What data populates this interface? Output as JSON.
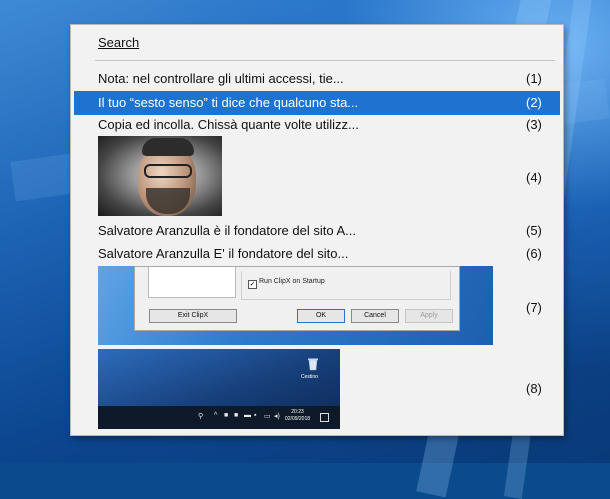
{
  "menu": {
    "search_label": "Search",
    "items": [
      {
        "label": "Nota: nel controllare gli ultimi accessi, tie...",
        "key": "(1)"
      },
      {
        "label": "Il tuo “sesto senso” ti dice che qualcuno sta...",
        "key": "(2)",
        "selected": true
      },
      {
        "label": "Copia ed incolla. Chissà quante volte utilizz...",
        "key": "(3)"
      },
      {
        "key": "(4)",
        "thumbnail": "portrait-photo"
      },
      {
        "label": "Salvatore Aranzulla è il fondatore del sito A...",
        "key": "(5)"
      },
      {
        "label": "Salvatore Aranzulla  E' il fondatore del sito...",
        "key": "(6)"
      },
      {
        "key": "(7)",
        "thumbnail": "clipx-dialog-screenshot"
      },
      {
        "key": "(8)",
        "thumbnail": "desktop-taskbar-screenshot"
      }
    ]
  },
  "clipx_dialog": {
    "startup_checkbox": "Run ClipX on Startup",
    "exit_button": "Exit ClipX",
    "ok_button": "OK",
    "cancel_button": "Cancel",
    "apply_button": "Apply"
  },
  "desktop_shot": {
    "recycle_label": "Cestino",
    "time": "20:23",
    "date": "02/09/2018"
  },
  "colors": {
    "selection": "#1e73d1",
    "menu_bg": "#f2f2f2"
  }
}
